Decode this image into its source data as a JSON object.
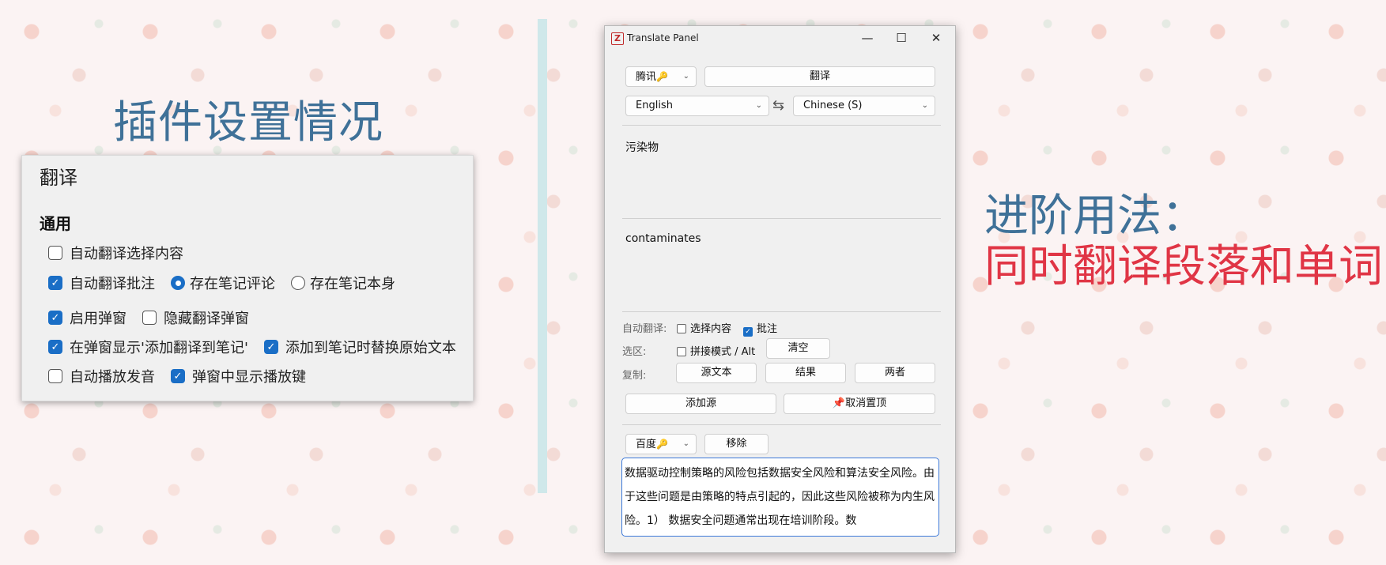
{
  "headings": {
    "left": "插件设置情况",
    "right_line1": "进阶用法：",
    "right_line2": "同时翻译段落和单词"
  },
  "settings": {
    "title": "翻译",
    "section": "通用",
    "options": {
      "auto_translate_selection": {
        "label": "自动翻译选择内容",
        "checked": false
      },
      "auto_translate_annotation": {
        "label": "自动翻译批注",
        "checked": true
      },
      "save_note_comment": {
        "label": "存在笔记评论",
        "selected": true
      },
      "save_note_body": {
        "label": "存在笔记本身",
        "selected": false
      },
      "enable_popup": {
        "label": "启用弹窗",
        "checked": true
      },
      "hide_translate_popup": {
        "label": "隐藏翻译弹窗",
        "checked": false
      },
      "show_add_to_note": {
        "label": "在弹窗显示'添加翻译到笔记'",
        "checked": true
      },
      "replace_original_text": {
        "label": "添加到笔记时替换原始文本",
        "checked": true
      },
      "auto_play_audio": {
        "label": "自动播放发音",
        "checked": false
      },
      "show_play_button": {
        "label": "弹窗中显示播放键",
        "checked": true
      }
    }
  },
  "translate_panel": {
    "window_title": "Translate Panel",
    "window_controls": {
      "minimize": "—",
      "maximize": "☐",
      "close": "✕"
    },
    "engine": "腾讯",
    "translate_button": "翻译",
    "source_language": "English",
    "swap_symbol": "⇆",
    "target_language": "Chinese (S)",
    "result_text": "污染物",
    "source_text": "contaminates",
    "auto_translate": {
      "label": "自动翻译:",
      "selection": {
        "label": "选择内容",
        "checked": false
      },
      "annotation": {
        "label": "批注",
        "checked": true
      }
    },
    "select_area": {
      "label": "选区:",
      "concat_mode": {
        "label": "拼接模式 / Alt",
        "checked": false
      },
      "clear_button": "清空"
    },
    "copy": {
      "label": "复制:",
      "source_button": "源文本",
      "result_button": "结果",
      "both_button": "两者"
    },
    "add_source_button": "添加源",
    "unpin_button": "取消置顶",
    "extra_engine": "百度",
    "remove_button": "移除",
    "extra_result": "数据驱动控制策略的风险包括数据安全风险和算法安全风险。由于这些问题是由策略的特点引起的，因此这些风险被称为内生风险。1） 数据安全问题通常出现在培训阶段。数"
  },
  "colors": {
    "accent_blue": "#1a6ec6",
    "heading_blue": "#3f7198",
    "heading_red": "#e03545",
    "divider": "#cfe8ea"
  }
}
